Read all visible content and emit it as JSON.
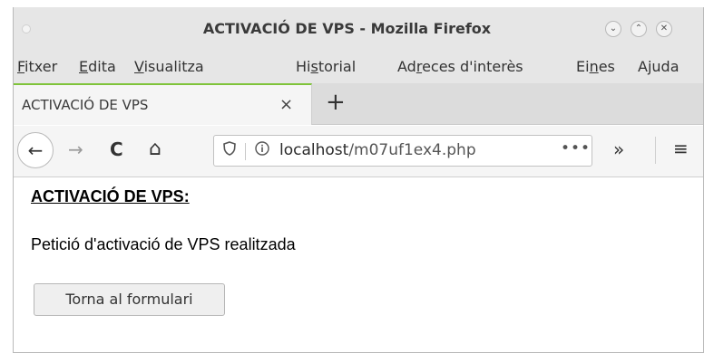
{
  "window": {
    "title": "ACTIVACIÓ DE VPS - Mozilla Firefox",
    "buttons": {
      "minimize": "⌄",
      "maximize": "⌃",
      "close": "✕"
    }
  },
  "menubar": {
    "items": [
      {
        "label": "Fitxer",
        "underline_prefix": "",
        "underline_char": "F",
        "rest": "itxer"
      },
      {
        "label": "Edita",
        "underline_prefix": "",
        "underline_char": "E",
        "rest": "dita"
      },
      {
        "label": "Visualitza",
        "underline_prefix": "",
        "underline_char": "V",
        "rest": "isualitza"
      },
      {
        "label": "Historial",
        "underline_prefix": "Hi",
        "underline_char": "s",
        "rest": "torial"
      },
      {
        "label": "Adreces d'interès",
        "underline_prefix": "Ad",
        "underline_char": "r",
        "rest": "eces d'interès"
      },
      {
        "label": "Eines",
        "underline_prefix": "Ei",
        "underline_char": "n",
        "rest": "es"
      },
      {
        "label": "Ajuda",
        "underline_prefix": "A",
        "underline_char": "j",
        "rest": "uda"
      }
    ]
  },
  "tabs": {
    "active": {
      "title": "ACTIVACIÓ DE VPS",
      "close_glyph": "×"
    },
    "new_tab_glyph": "+"
  },
  "navbar": {
    "back_glyph": "←",
    "forward_glyph": "→",
    "reload_glyph": "C",
    "home_glyph": "⌂",
    "url_host": "localhost",
    "url_path": "/m07uf1ex4.php",
    "page_actions_glyph": "•••",
    "overflow_glyph": "»",
    "menu_glyph": "≡"
  },
  "page": {
    "heading": "ACTIVACIÓ DE VPS:",
    "message": "Petició d'activació de VPS realitzada",
    "return_button": "Torna al formulari"
  },
  "colors": {
    "chrome_bg": "#e6e6e6",
    "tab_accent": "#7fc33a",
    "page_bg": "#ffffff"
  }
}
